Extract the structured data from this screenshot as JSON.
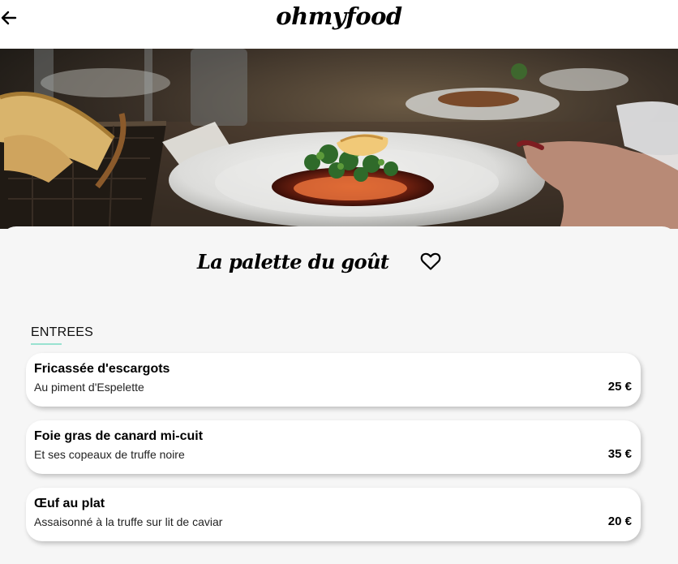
{
  "header": {
    "brand": "ohmyfood",
    "back_icon": "arrow-left-icon"
  },
  "hero": {
    "image_subject": "plated dish on a restaurant table"
  },
  "restaurant": {
    "name": "La palette du goût",
    "favorite_icon": "heart-outline-icon"
  },
  "menu": {
    "section_title": "ENTREES",
    "accent_color": "#99e2d0",
    "dishes": [
      {
        "name": "Fricassée d'escargots",
        "description": "Au piment d'Espelette",
        "price": "25 €"
      },
      {
        "name": "Foie gras de canard mi-cuit",
        "description": "Et ses copeaux de truffe noire",
        "price": "35 €"
      },
      {
        "name": "Œuf au plat",
        "description": "Assaisonné à la truffe sur lit de caviar",
        "price": "20 €"
      }
    ]
  }
}
